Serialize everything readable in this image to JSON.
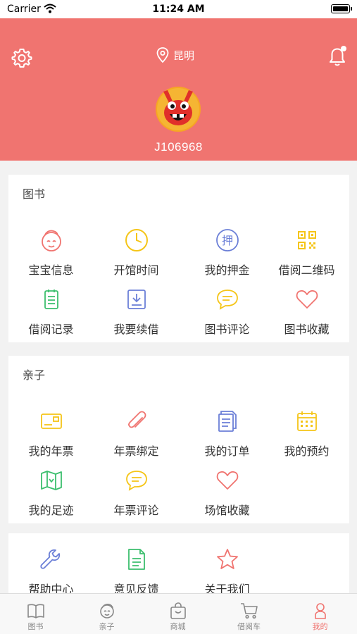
{
  "status_bar": {
    "carrier": "Carrier",
    "time": "11:24 AM"
  },
  "header": {
    "city": "昆明",
    "user_id": "J106968",
    "bg_color": "#f07470"
  },
  "sections": [
    {
      "title": "图书",
      "items": [
        {
          "label": "宝宝信息",
          "icon": "baby-face-icon",
          "color": "#f07470"
        },
        {
          "label": "开馆时间",
          "icon": "clock-icon",
          "color": "#f5c518"
        },
        {
          "label": "我的押金",
          "icon": "deposit-icon",
          "icon_text": "押",
          "color": "#6b7fd7"
        },
        {
          "label": "借阅二维码",
          "icon": "qr-code-icon",
          "color": "#f5c518"
        },
        {
          "label": "借阅记录",
          "icon": "clipboard-icon",
          "color": "#3cbf6e"
        },
        {
          "label": "我要续借",
          "icon": "download-box-icon",
          "color": "#6b7fd7"
        },
        {
          "label": "图书评论",
          "icon": "chat-bubble-icon",
          "color": "#f5c518"
        },
        {
          "label": "图书收藏",
          "icon": "heart-icon",
          "color": "#f07470"
        }
      ]
    },
    {
      "title": "亲子",
      "items": [
        {
          "label": "我的年票",
          "icon": "card-icon",
          "color": "#f5c518"
        },
        {
          "label": "年票绑定",
          "icon": "paperclip-icon",
          "color": "#f07470"
        },
        {
          "label": "我的订单",
          "icon": "documents-icon",
          "color": "#6b7fd7"
        },
        {
          "label": "我的预约",
          "icon": "calendar-icon",
          "color": "#f5c518"
        },
        {
          "label": "我的足迹",
          "icon": "map-icon",
          "color": "#3cbf6e"
        },
        {
          "label": "年票评论",
          "icon": "chat-bubble-icon",
          "color": "#f5c518"
        },
        {
          "label": "场馆收藏",
          "icon": "heart-icon",
          "color": "#f07470"
        }
      ]
    },
    {
      "title": "",
      "items": [
        {
          "label": "帮助中心",
          "icon": "wrench-icon",
          "color": "#6b7fd7"
        },
        {
          "label": "意见反馈",
          "icon": "feedback-doc-icon",
          "color": "#3cbf6e"
        },
        {
          "label": "关于我们",
          "icon": "star-icon",
          "color": "#f07470"
        }
      ]
    }
  ],
  "tabbar": {
    "active_color": "#f07470",
    "tabs": [
      {
        "label": "图书",
        "icon": "book-icon"
      },
      {
        "label": "亲子",
        "icon": "child-icon"
      },
      {
        "label": "商城",
        "icon": "shopping-bag-icon"
      },
      {
        "label": "借阅车",
        "icon": "cart-icon"
      },
      {
        "label": "我的",
        "icon": "person-icon",
        "active": true
      }
    ]
  }
}
